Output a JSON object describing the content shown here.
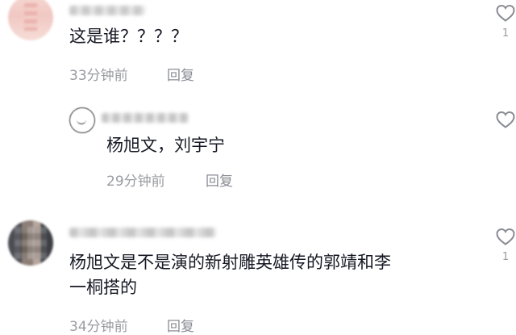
{
  "comments": [
    {
      "text": "这是谁？？？？",
      "time": "33分钟前",
      "reply_label": "回复",
      "likes": "1"
    },
    {
      "text": "杨旭文，刘宇宁",
      "time": "29分钟前",
      "reply_label": "回复",
      "likes": ""
    },
    {
      "text_line1": "杨旭文是不是演的新射雕英雄传的郭靖和李",
      "text_line2": "一桐搭的",
      "time": "34分钟前",
      "reply_label": "回复",
      "likes": "1"
    }
  ],
  "icons": {
    "like": "heart-outline-icon"
  },
  "colors": {
    "text": "#161823",
    "meta": "#9a9ca3",
    "icon": "#8a8c94"
  }
}
